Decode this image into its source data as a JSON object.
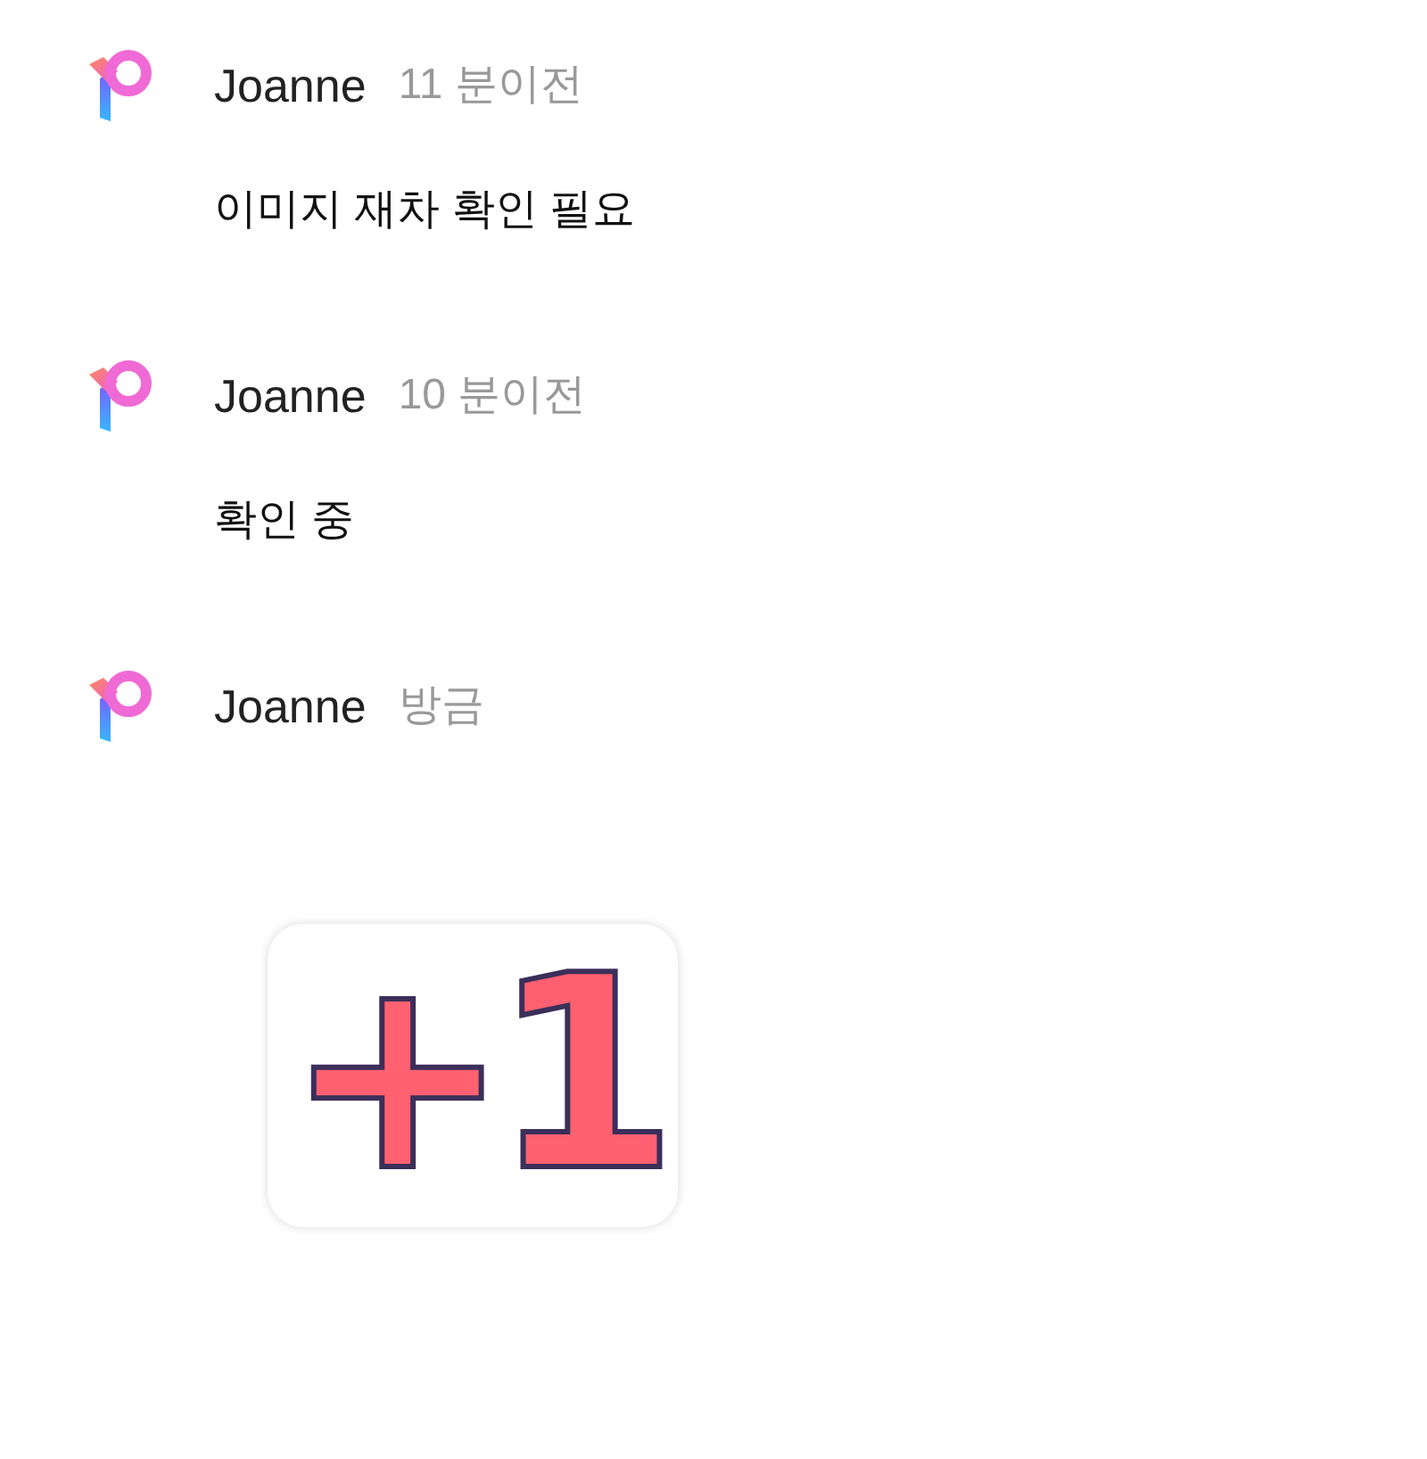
{
  "messages": [
    {
      "author": "Joanne",
      "time": "11 분이전",
      "kind": "text",
      "text": "이미지 재차 확인 필요"
    },
    {
      "author": "Joanne",
      "time": "10 분이전",
      "kind": "text",
      "text": "확인 중"
    },
    {
      "author": "Joanne",
      "time": "방금",
      "kind": "sticker",
      "text": "+1"
    }
  ]
}
